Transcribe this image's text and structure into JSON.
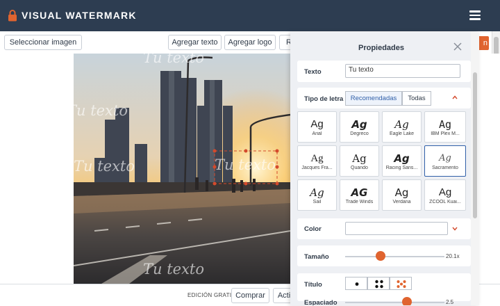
{
  "app": {
    "brand": "VISUAL WATERMARK"
  },
  "toolbar": {
    "select_image": "Seleccionar imagen",
    "add_text": "Agregar texto",
    "add_logo": "Agregar logo",
    "partial_button": "Re",
    "orange_button_partial": "n"
  },
  "watermark": {
    "text": "Tu texto",
    "repeat_count": 7
  },
  "bottombar": {
    "edition": "EDICIÓN GRATIS",
    "buy": "Comprar",
    "partial": "Acti"
  },
  "panel": {
    "title": "Propiedades",
    "text_label": "Texto",
    "text_value": "Tu texto",
    "font_label": "Tipo de letra",
    "font_tabs": [
      "Recomendadas",
      "Todas"
    ],
    "font_tab_active": "Recomendadas",
    "fonts": [
      {
        "sample": "Ag",
        "name": "Arial"
      },
      {
        "sample": "Ag",
        "name": "Degreco"
      },
      {
        "sample": "Ag",
        "name": "Eagle Lake"
      },
      {
        "sample": "Ag",
        "name": "IBM Plex M..."
      },
      {
        "sample": "Ag",
        "name": "Jacques Fra..."
      },
      {
        "sample": "Ag",
        "name": "Quando"
      },
      {
        "sample": "Ag",
        "name": "Racing Sans..."
      },
      {
        "sample": "Ag",
        "name": "Sacramento"
      },
      {
        "sample": "Ag",
        "name": "Sail"
      },
      {
        "sample": "AG",
        "name": "Trade Winds"
      },
      {
        "sample": "Ag",
        "name": "Verdana"
      },
      {
        "sample": "Ag",
        "name": "ZCOOL Kuai..."
      }
    ],
    "selected_font": "Sacramento",
    "color_label": "Color",
    "color_value": "",
    "size_label": "Tamaño",
    "size_value": "20.1x",
    "size_fraction": 0.36,
    "title_label": "Título",
    "spacing_label": "Espaciado",
    "spacing_value": "2.5",
    "spacing_fraction": 0.62
  },
  "colors": {
    "topbar": "#2d3d51",
    "accent": "#e0642f",
    "selected_border": "#2f5fa8"
  }
}
